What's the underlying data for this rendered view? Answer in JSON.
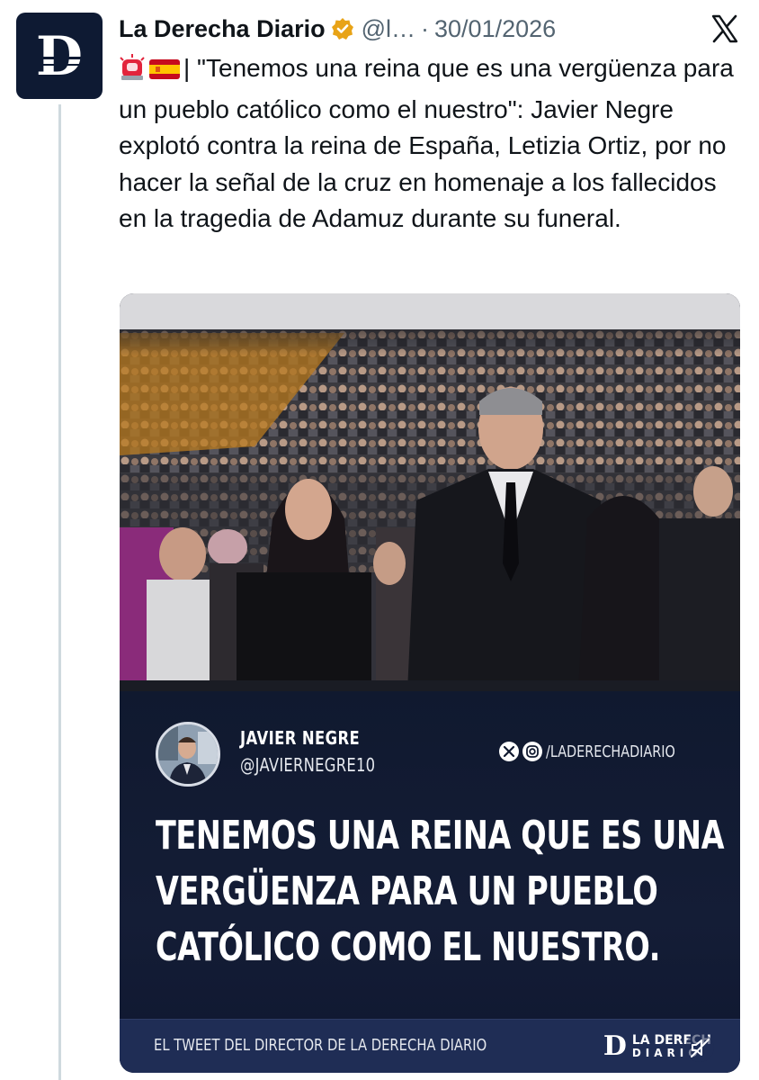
{
  "author": {
    "name": "La Derecha Diario",
    "handle": "@l…",
    "separator": "·",
    "date": "30/01/2026",
    "avatar_letter": "D"
  },
  "tweet": {
    "emojis": [
      "police-light-emoji",
      "spain-flag-emoji"
    ],
    "text": "| \"Tenemos una reina que es una vergüenza para un pueblo católico como el nuestro\": Javier Negre explotó contra la reina de España, Letizia Ortiz, por no hacer la señal de la cruz en homenaje a los fallecidos en la tragedia de Adamuz durante su funeral."
  },
  "media": {
    "card_name": "JAVIER NEGRE",
    "card_handle": "@JAVIERNEGRE10",
    "card_social": "/LADERECHADIARIO",
    "quote_lines": [
      "TENEMOS UNA REINA QUE ES UNA",
      "VERGÜENZA PARA UN PUEBLO",
      "CATÓLICO COMO EL NUESTRO."
    ],
    "footer_text": "EL TWEET DEL DIRECTOR DE LA DERECHA DIARIO",
    "footer_logo_letter": "D",
    "footer_logo_line1": "LA DERECH",
    "footer_logo_line2": "DIARIO"
  },
  "colors": {
    "verified_badge": "#e8a317",
    "handle_gray": "#536471",
    "brand_navy": "#0e1a33"
  },
  "icons": [
    "verified-badge-icon",
    "x-logo-icon",
    "mute-icon",
    "instagram-icon"
  ]
}
